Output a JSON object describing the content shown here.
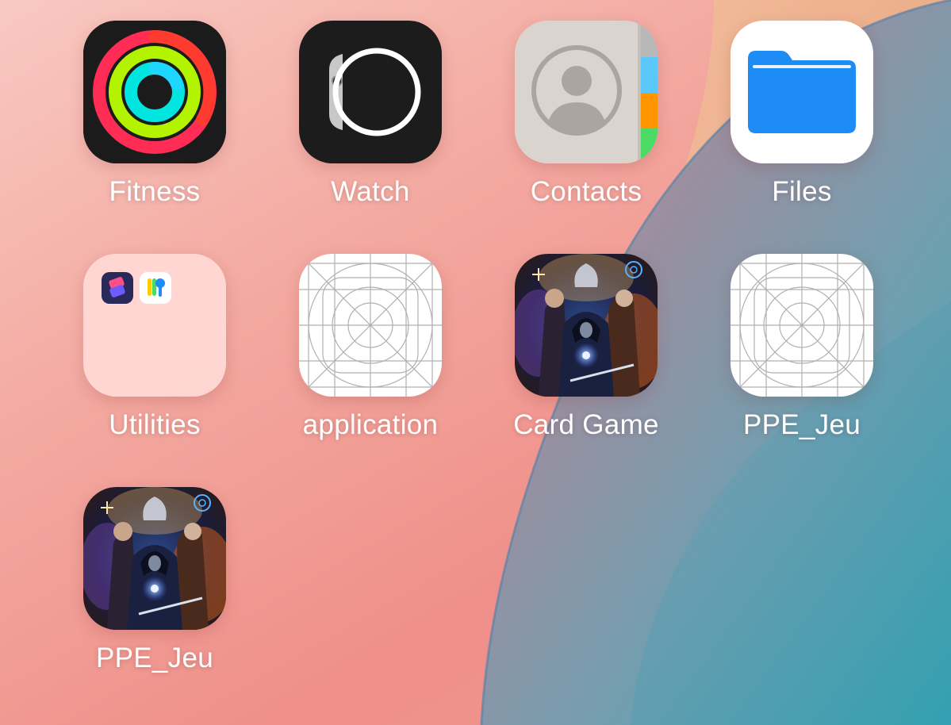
{
  "home_screen": {
    "apps": [
      {
        "name": "Fitness",
        "icon": "fitness-rings-icon"
      },
      {
        "name": "Watch",
        "icon": "watch-icon"
      },
      {
        "name": "Contacts",
        "icon": "contacts-icon"
      },
      {
        "name": "Files",
        "icon": "folder-icon"
      },
      {
        "name": "Utilities",
        "icon": "folder-utilities-icon",
        "contains": [
          "shortcuts-icon",
          "passwords-icon"
        ]
      },
      {
        "name": "application",
        "icon": "placeholder-grid-icon"
      },
      {
        "name": "Card Game",
        "icon": "card-game-art-icon"
      },
      {
        "name": "PPE_Jeu",
        "icon": "placeholder-grid-icon"
      },
      {
        "name": "PPE_Jeu",
        "icon": "card-game-art-icon"
      }
    ]
  },
  "colors": {
    "fitness_move": "#ff2d55",
    "fitness_exercise": "#b4f300",
    "fitness_stand": "#00e5e0",
    "files_blue": "#1e8cf5",
    "contacts_gray": "#d9d4ce"
  }
}
